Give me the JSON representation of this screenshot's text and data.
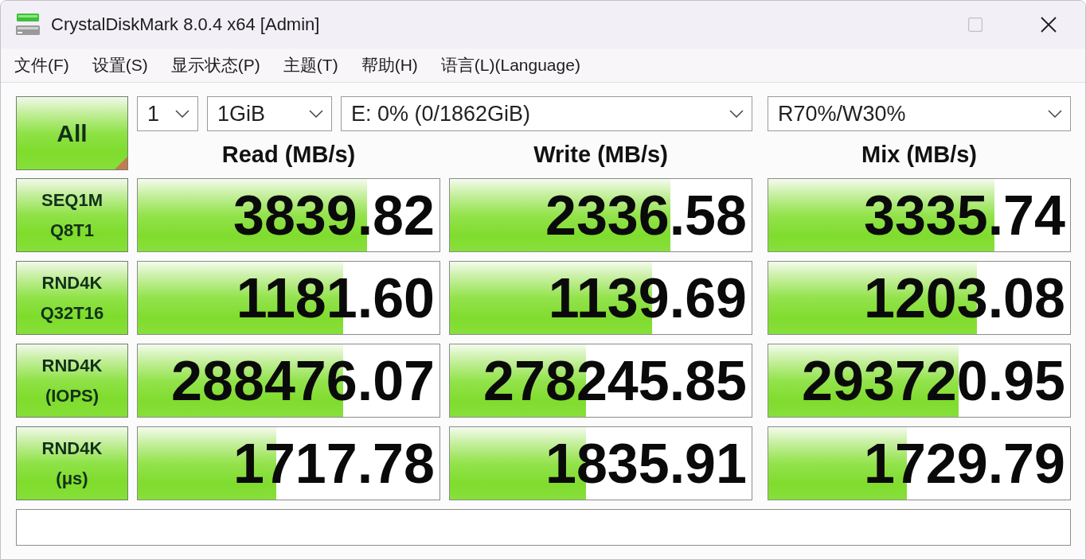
{
  "window": {
    "title": "CrystalDiskMark 8.0.4 x64 [Admin]",
    "controls": [
      {
        "kind": "maximize",
        "disabled": true
      },
      {
        "kind": "close",
        "disabled": false
      }
    ]
  },
  "menu": [
    {
      "label": "文件(F)"
    },
    {
      "label": "设置(S)"
    },
    {
      "label": "显示状态(P)"
    },
    {
      "label": "主题(T)"
    },
    {
      "label": "帮助(H)"
    },
    {
      "label": "语言(L)(Language)"
    }
  ],
  "all_button": {
    "label": "All"
  },
  "dropdowns": [
    {
      "value": "1"
    },
    {
      "value": "1GiB"
    },
    {
      "value": "E: 0% (0/1862GiB)"
    },
    {
      "value": "R70%/W30%"
    }
  ],
  "columns": [
    {
      "label": "Read (MB/s)"
    },
    {
      "label": "Write (MB/s)"
    },
    {
      "label": "Mix (MB/s)"
    }
  ],
  "tests": [
    {
      "label": [
        "SEQ1M",
        "Q8T1"
      ],
      "results": [
        {
          "value": "3839.82",
          "level": 0.76
        },
        {
          "value": "2336.58",
          "level": 0.73
        },
        {
          "value": "3335.74",
          "level": 0.75
        }
      ]
    },
    {
      "label": [
        "RND4K",
        "Q32T16"
      ],
      "results": [
        {
          "value": "1181.60",
          "level": 0.68
        },
        {
          "value": "1139.69",
          "level": 0.67
        },
        {
          "value": "1203.08",
          "level": 0.69
        }
      ]
    },
    {
      "label": [
        "RND4K",
        "(IOPS)"
      ],
      "results": [
        {
          "value": "288476.07",
          "level": 0.68
        },
        {
          "value": "278245.85",
          "level": 0.45
        },
        {
          "value": "293720.95",
          "level": 0.63
        }
      ]
    },
    {
      "label": [
        "RND4K",
        "(μs)"
      ],
      "results": [
        {
          "value": "1717.78",
          "level": 0.46
        },
        {
          "value": "1835.91",
          "level": 0.45
        },
        {
          "value": "1729.79",
          "level": 0.46
        }
      ]
    }
  ]
}
